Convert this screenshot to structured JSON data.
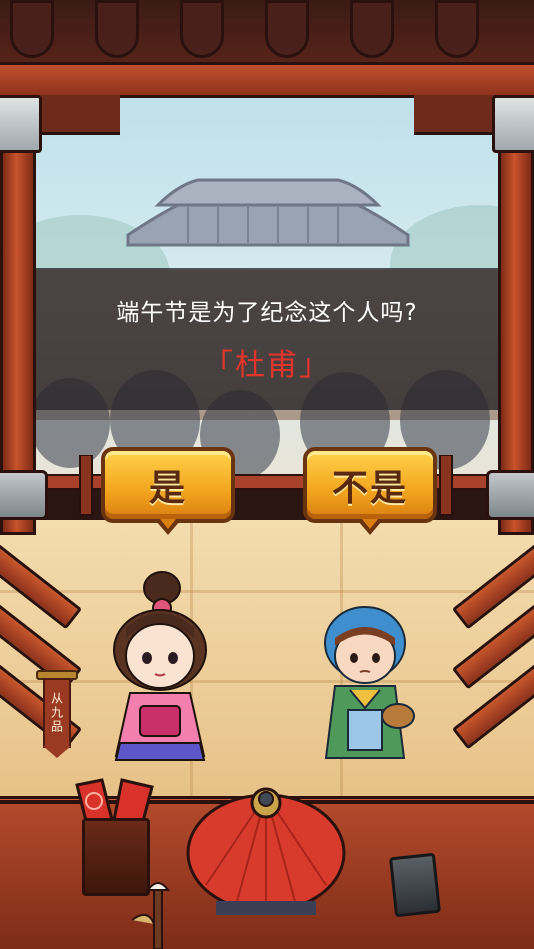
{
  "question": {
    "text": "端午节是为了纪念这个人吗?",
    "answer_name": "「杜甫」"
  },
  "buttons": {
    "yes_label": "是",
    "no_label": "不是"
  },
  "rank": {
    "label": "从九品"
  },
  "colors": {
    "answer_name": "#e4352c",
    "button_fill": "#f2a41e",
    "button_text": "#5a2a10",
    "banner": "#282428"
  },
  "characters": [
    {
      "icon": "lady-character-icon"
    },
    {
      "icon": "villager-woman-character-icon"
    },
    {
      "icon": "judge-official-hat-icon"
    }
  ]
}
